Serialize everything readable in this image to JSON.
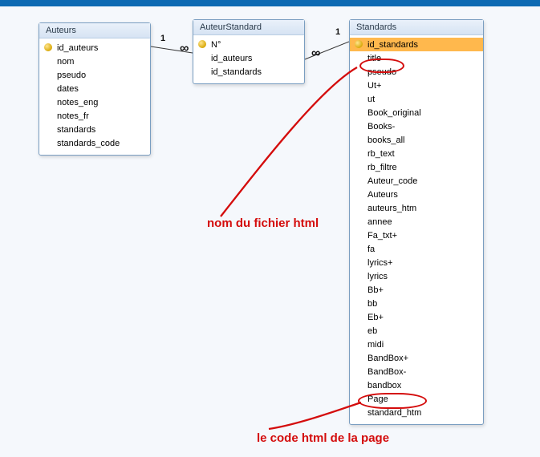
{
  "tables": {
    "auteurs": {
      "title": "Auteurs",
      "fields": [
        "id_auteurs",
        "nom",
        "pseudo",
        "dates",
        "notes_eng",
        "notes_fr",
        "standards",
        "standards_code"
      ]
    },
    "auteurStandard": {
      "title": "AuteurStandard",
      "fields": [
        "N°",
        "id_auteurs",
        "id_standards"
      ]
    },
    "standards": {
      "title": "Standards",
      "fields": [
        "id_standards",
        "title",
        "pseudo",
        "Ut+",
        "ut",
        "Book_original",
        "Books-",
        "books_all",
        "rb_text",
        "rb_filtre",
        "Auteur_code",
        "Auteurs",
        "auteurs_htm",
        "annee",
        "Fa_txt+",
        "fa",
        "lyrics+",
        "lyrics",
        "Bb+",
        "bb",
        "Eb+",
        "eb",
        "midi",
        "BandBox+",
        "BandBox-",
        "bandbox",
        "Page",
        "standard_htm"
      ]
    }
  },
  "relations": {
    "r1": {
      "one": "1",
      "many": "∞"
    },
    "r2": {
      "one": "1",
      "many": "∞"
    }
  },
  "annotations": {
    "a1": "nom du fichier html",
    "a2": "le code html de la page"
  }
}
